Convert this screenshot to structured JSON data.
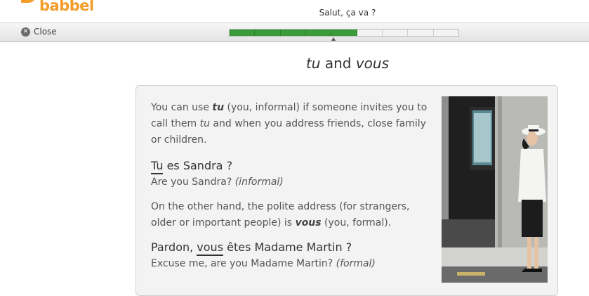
{
  "brand": {
    "name": "babbel",
    "color": "#f39c28"
  },
  "lesson_title": "Salut, ça va ?",
  "toolbar": {
    "close_label": "Close",
    "close_icon": "close-icon"
  },
  "progress": {
    "segments_total": 9,
    "segments_done": 5,
    "done_color": "#3a9b3a"
  },
  "heading": {
    "word1": "tu",
    "connector": " and ",
    "word2": "vous"
  },
  "card": {
    "para1": {
      "t1": "You can use ",
      "b1": "tu",
      "t2": " (you, informal) if someone invites you to call them ",
      "i1": "tu",
      "t3": " and when you address friends, close family or children."
    },
    "example1": {
      "underlined": "Tu",
      "rest": " es Sandra ?"
    },
    "translation1": {
      "text": "Are you Sandra? ",
      "note": "(informal)"
    },
    "para2": {
      "t1": "On the other hand, the polite address (for strangers, older or important people) is ",
      "b1": "vous",
      "t2": " (you, formal)."
    },
    "example2": {
      "before": "Pardon, ",
      "underlined": "vous",
      "after": " êtes Madame Martin ?"
    },
    "translation2": {
      "text": "Excuse me, are you Madame Martin? ",
      "note": "(formal)"
    }
  }
}
